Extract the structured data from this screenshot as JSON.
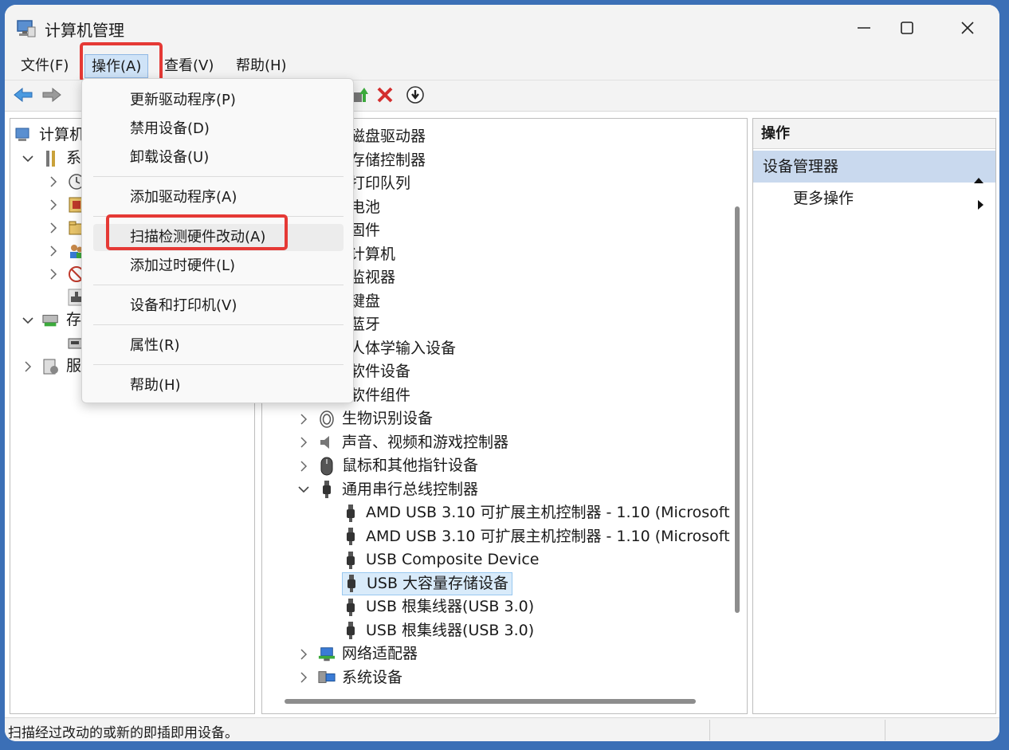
{
  "window": {
    "title": "计算机管理",
    "minimize_icon": "minimize-icon",
    "maximize_icon": "maximize-icon",
    "close_icon": "close-icon"
  },
  "menubar": {
    "items": [
      {
        "label": "文件(F)"
      },
      {
        "label": "操作(A)"
      },
      {
        "label": "查看(V)"
      },
      {
        "label": "帮助(H)"
      }
    ],
    "active_index": 1
  },
  "dropdown": {
    "items": [
      {
        "label": "更新驱动程序(P)"
      },
      {
        "label": "禁用设备(D)"
      },
      {
        "label": "卸载设备(U)"
      },
      {
        "label": "添加驱动程序(A)"
      },
      {
        "label": "扫描检测硬件改动(A)"
      },
      {
        "label": "添加过时硬件(L)"
      },
      {
        "label": "设备和打印机(V)"
      },
      {
        "label": "属性(R)"
      },
      {
        "label": "帮助(H)"
      }
    ]
  },
  "left_tree": {
    "items": [
      {
        "label": "计算机"
      },
      {
        "label": "系"
      },
      {
        "label": "存"
      },
      {
        "label": "服"
      }
    ]
  },
  "device_tree": {
    "items": [
      {
        "label": "磁盘驱动器"
      },
      {
        "label": "存储控制器"
      },
      {
        "label": "打印队列"
      },
      {
        "label": "电池"
      },
      {
        "label": "固件"
      },
      {
        "label": "计算机"
      },
      {
        "label": "监视器"
      },
      {
        "label": "键盘"
      },
      {
        "label": "蓝牙"
      },
      {
        "label": "人体学输入设备"
      },
      {
        "label": "软件设备"
      },
      {
        "label": "软件组件"
      },
      {
        "label": "生物识别设备"
      },
      {
        "label": "声音、视频和游戏控制器"
      },
      {
        "label": "鼠标和其他指针设备"
      },
      {
        "label": "通用串行总线控制器"
      },
      {
        "label": "AMD USB 3.10 可扩展主机控制器 - 1.10 (Microsoft"
      },
      {
        "label": "AMD USB 3.10 可扩展主机控制器 - 1.10 (Microsoft"
      },
      {
        "label": "USB Composite Device"
      },
      {
        "label": "USB 大容量存储设备"
      },
      {
        "label": "USB 根集线器(USB 3.0)"
      },
      {
        "label": "USB 根集线器(USB 3.0)"
      },
      {
        "label": "网络适配器"
      },
      {
        "label": "系统设备"
      }
    ],
    "selected_label": "USB 大容量存储设备"
  },
  "actions_pane": {
    "header": "操作",
    "section": "设备管理器",
    "more": "更多操作"
  },
  "statusbar": {
    "text": "扫描经过改动的或新的即插即用设备。"
  },
  "colors": {
    "frame": "#3b6fb6",
    "highlight_red": "#e53935",
    "section_bg": "#c9d9ee",
    "selection_bg": "#d9ebfa"
  }
}
